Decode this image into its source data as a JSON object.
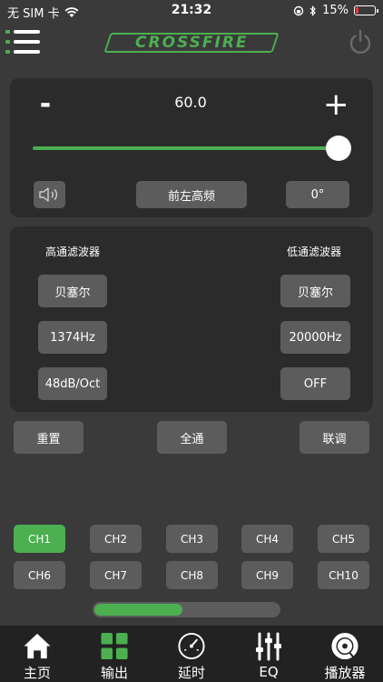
{
  "status_bar": {
    "carrier": "无 SIM 卡",
    "time": "21:32",
    "battery": "15%",
    "battery_level": 0.15
  },
  "header": {
    "logo_text": "CROSSFIRE",
    "menu_icon": "menu-icon",
    "power_icon": "power-icon"
  },
  "gain": {
    "minus_label": "-",
    "plus_label": "+",
    "value": "60.0",
    "slider_fraction": 1.0
  },
  "channel_controls": {
    "speaker_icon": "speaker-icon",
    "channel_name": "前左高频",
    "phase": "0°"
  },
  "filters": {
    "high_pass": {
      "title": "高通滤波器",
      "type": "贝塞尔",
      "frequency": "1374Hz",
      "slope": "48dB/Oct"
    },
    "low_pass": {
      "title": "低通滤波器",
      "type": "贝塞尔",
      "frequency": "20000Hz",
      "slope": "OFF"
    }
  },
  "actions": {
    "reset": "重置",
    "all_pass": "全通",
    "link": "联调"
  },
  "channels": [
    "CH1",
    "CH2",
    "CH3",
    "CH4",
    "CH5",
    "CH6",
    "CH7",
    "CH8",
    "CH9",
    "CH10"
  ],
  "selected_channel": "CH1",
  "progress_fraction": 0.48,
  "tabs": [
    {
      "label": "主页",
      "icon": "home-icon"
    },
    {
      "label": "输出",
      "icon": "grid-icon"
    },
    {
      "label": "延时",
      "icon": "gauge-icon"
    },
    {
      "label": "EQ",
      "icon": "equalizer-icon"
    },
    {
      "label": "播放器",
      "icon": "disc-icon"
    }
  ],
  "colors": {
    "accent": "#4caf50",
    "background": "#3a3a3a",
    "panel": "#2b2b2b",
    "button": "#5c5c5c"
  }
}
